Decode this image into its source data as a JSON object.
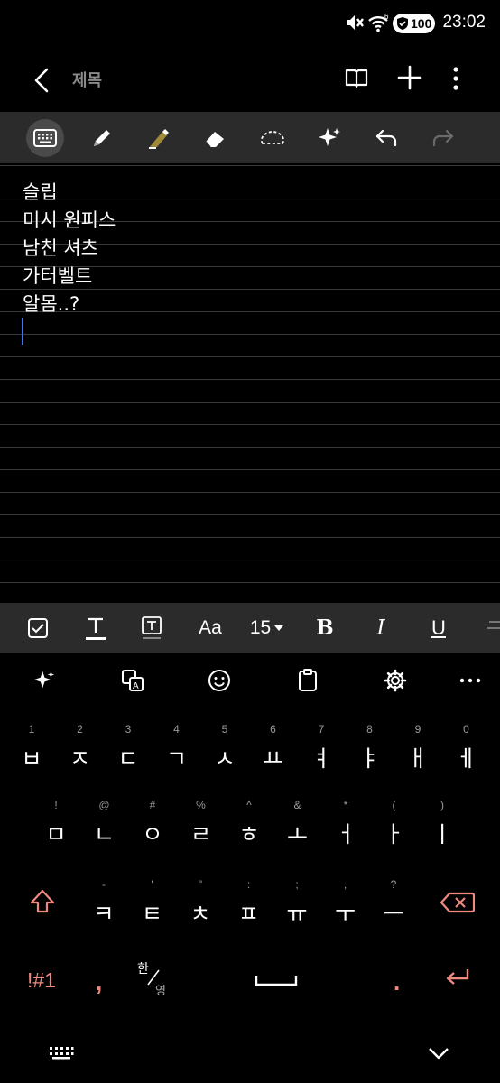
{
  "status": {
    "time": "23:02",
    "battery": "100",
    "wifi_badge": "6"
  },
  "app": {
    "title": "제목"
  },
  "note": {
    "lines": [
      "슬립",
      "미시 원피스",
      "남친 셔츠",
      "가터벨트",
      "알몸..?"
    ]
  },
  "format": {
    "font_size": "15",
    "font_label": "Aa",
    "bold": "B",
    "italic": "I",
    "underline": "U"
  },
  "keyboard": {
    "row1": [
      {
        "hint": "1",
        "key": "ㅂ"
      },
      {
        "hint": "2",
        "key": "ㅈ"
      },
      {
        "hint": "3",
        "key": "ㄷ"
      },
      {
        "hint": "4",
        "key": "ㄱ"
      },
      {
        "hint": "5",
        "key": "ㅅ"
      },
      {
        "hint": "6",
        "key": "ㅛ"
      },
      {
        "hint": "7",
        "key": "ㅕ"
      },
      {
        "hint": "8",
        "key": "ㅑ"
      },
      {
        "hint": "9",
        "key": "ㅐ"
      },
      {
        "hint": "0",
        "key": "ㅔ"
      }
    ],
    "row2": [
      {
        "hint": "!",
        "key": "ㅁ"
      },
      {
        "hint": "@",
        "key": "ㄴ"
      },
      {
        "hint": "#",
        "key": "ㅇ"
      },
      {
        "hint": "%",
        "key": "ㄹ"
      },
      {
        "hint": "^",
        "key": "ㅎ"
      },
      {
        "hint": "&",
        "key": "ㅗ"
      },
      {
        "hint": "*",
        "key": "ㅓ"
      },
      {
        "hint": "(",
        "key": "ㅏ"
      },
      {
        "hint": ")",
        "key": "ㅣ"
      }
    ],
    "row3": [
      {
        "hint": "-",
        "key": "ㅋ"
      },
      {
        "hint": "'",
        "key": "ㅌ"
      },
      {
        "hint": "\"",
        "key": "ㅊ"
      },
      {
        "hint": ":",
        "key": "ㅍ"
      },
      {
        "hint": ";",
        "key": "ㅠ"
      },
      {
        "hint": ",",
        "key": "ㅜ"
      },
      {
        "hint": "?",
        "key": "ㅡ"
      }
    ],
    "symbols_label": "!#1",
    "comma": ",",
    "lang_top": "한",
    "lang_bottom": "영",
    "period": "."
  },
  "colors": {
    "accent": "#f08a80",
    "caret": "#3d7bf0",
    "toolbar_bg": "#2b2b2b"
  }
}
